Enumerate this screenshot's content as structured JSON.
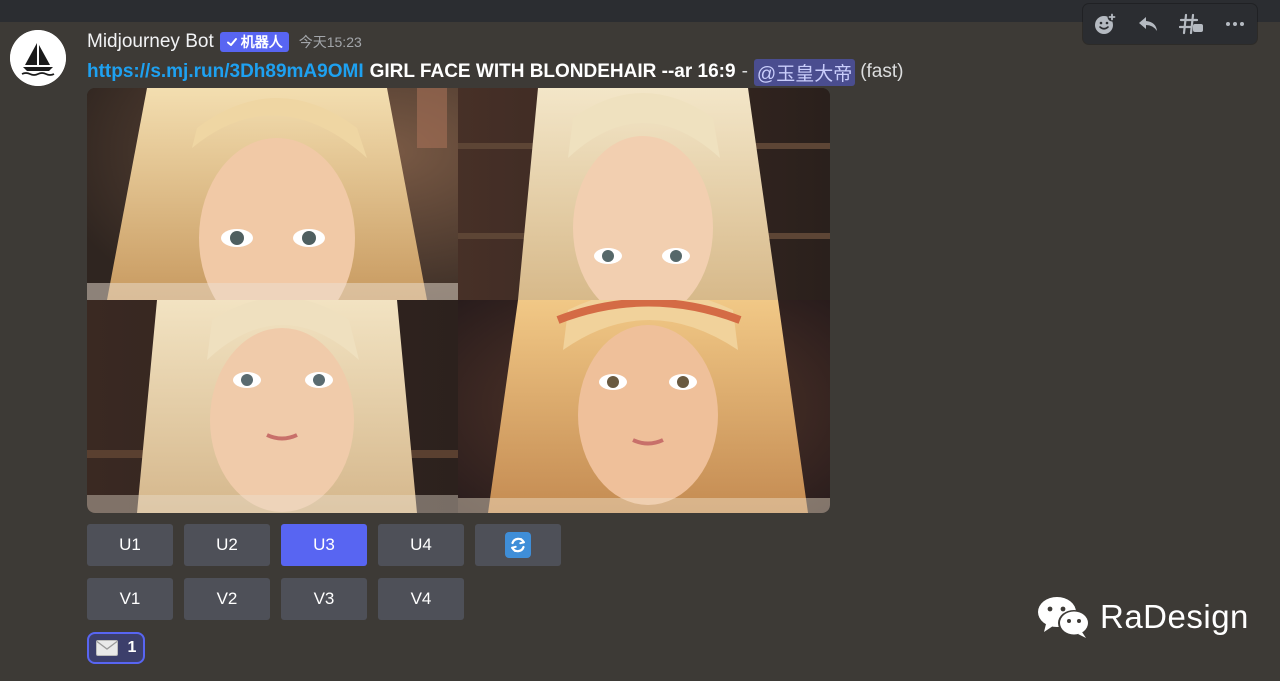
{
  "message": {
    "author": "Midjourney Bot",
    "bot_tag": "机器人",
    "timestamp": "今天15:23",
    "link": "https://s.mj.run/3Dh89mA9OMI",
    "prompt": "GIRL FACE WITH BLONDEHAIR --ar 16:9",
    "separator": "-",
    "mention": "@玉皇大帝",
    "speed": "(fast)"
  },
  "buttons": {
    "row1": [
      "U1",
      "U2",
      "U3",
      "U4"
    ],
    "row2": [
      "V1",
      "V2",
      "V3",
      "V4"
    ],
    "selected": "U3",
    "refresh_icon": "refresh-icon"
  },
  "reaction": {
    "icon": "envelope-icon",
    "count": "1"
  },
  "toolbar": {
    "icons": [
      "add-reaction-icon",
      "reply-icon",
      "create-thread-icon",
      "more-icon"
    ]
  },
  "watermark": {
    "text": "RaDesign",
    "icon": "wechat-icon"
  },
  "colors": {
    "background": "#3d3a36",
    "blurple": "#5865f2",
    "button_gray": "#4e5058",
    "link": "#1ea1f1"
  }
}
